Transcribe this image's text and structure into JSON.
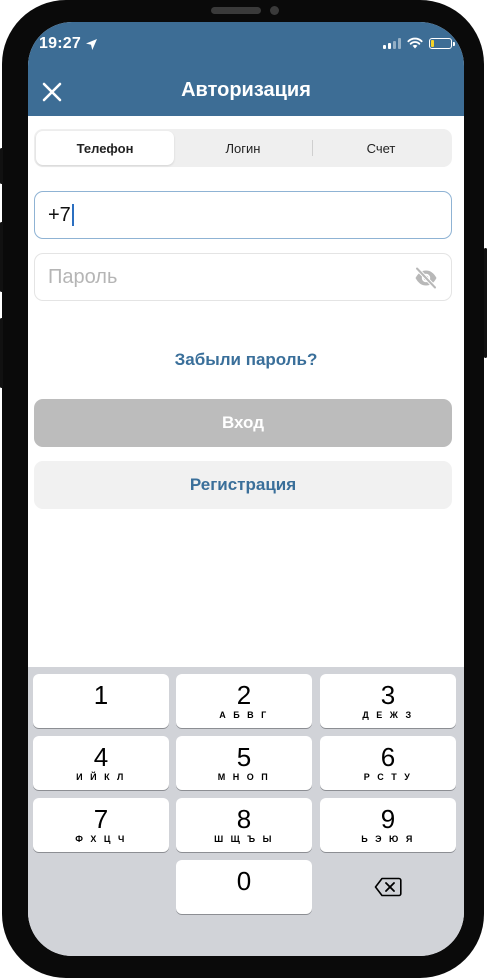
{
  "status_bar": {
    "time": "19:27"
  },
  "header": {
    "title": "Авторизация"
  },
  "tabs": [
    {
      "label": "Телефон",
      "active": true
    },
    {
      "label": "Логин",
      "active": false
    },
    {
      "label": "Счет",
      "active": false
    }
  ],
  "phone_input": {
    "value": "+7"
  },
  "password_input": {
    "placeholder": "Пароль"
  },
  "forgot_link": "Забыли пароль?",
  "login_button": "Вход",
  "register_button": "Регистрация",
  "keypad": [
    {
      "num": "1",
      "letters": ""
    },
    {
      "num": "2",
      "letters": "А Б В Г"
    },
    {
      "num": "3",
      "letters": "Д Е Ж З"
    },
    {
      "num": "4",
      "letters": "И Й К Л"
    },
    {
      "num": "5",
      "letters": "М Н О П"
    },
    {
      "num": "6",
      "letters": "Р С Т У"
    },
    {
      "num": "7",
      "letters": "Ф Х Ц Ч"
    },
    {
      "num": "8",
      "letters": "Ш Щ Ъ Ы"
    },
    {
      "num": "9",
      "letters": "Ь Э Ю Я"
    },
    {
      "num": "0",
      "letters": ""
    }
  ],
  "colors": {
    "header_bg": "#3d6d95",
    "link": "#3a6f9a",
    "login_disabled": "#bcbcbc",
    "keyboard_bg": "#d1d3d8"
  },
  "icons": {
    "close": "close-icon",
    "location": "location-arrow-icon",
    "wifi": "wifi-icon",
    "signal": "cellular-signal-icon",
    "battery": "battery-low-icon",
    "eye": "eye-off-icon",
    "delete": "backspace-icon"
  }
}
